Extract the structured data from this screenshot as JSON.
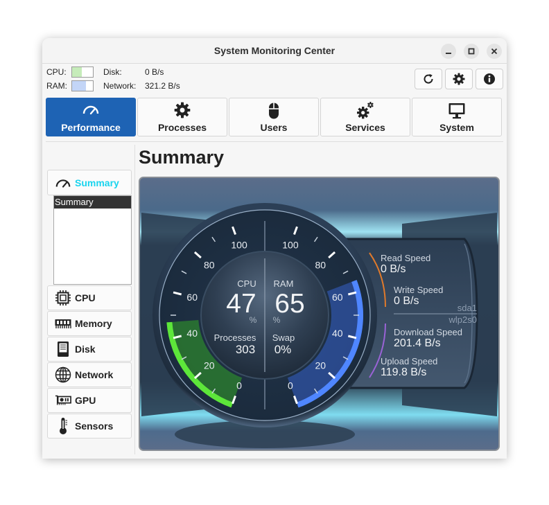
{
  "window": {
    "title": "System Monitoring Center"
  },
  "header": {
    "cpu_label": "CPU:",
    "ram_label": "RAM:",
    "cpu_usage": 0.47,
    "ram_usage": 0.65,
    "disk_label": "Disk:",
    "disk_value": "0 B/s",
    "network_label": "Network:",
    "network_value": "321.2 B/s"
  },
  "toolbar": {
    "refresh_icon": "refresh-icon",
    "settings_icon": "gear-icon",
    "about_icon": "info-icon"
  },
  "tabs": [
    {
      "label": "Performance",
      "icon": "speedometer-icon",
      "active": true
    },
    {
      "label": "Processes",
      "icon": "gear-icon"
    },
    {
      "label": "Users",
      "icon": "mouse-icon"
    },
    {
      "label": "Services",
      "icon": "gears-icon"
    },
    {
      "label": "System",
      "icon": "monitor-icon"
    }
  ],
  "sidebar": {
    "items": [
      {
        "label": "Summary",
        "icon": "speedometer-icon",
        "selected": true
      },
      {
        "label": "CPU",
        "icon": "cpu-icon"
      },
      {
        "label": "Memory",
        "icon": "memory-icon"
      },
      {
        "label": "Disk",
        "icon": "disk-icon"
      },
      {
        "label": "Network",
        "icon": "globe-icon"
      },
      {
        "label": "GPU",
        "icon": "gpu-icon"
      },
      {
        "label": "Sensors",
        "icon": "thermometer-icon"
      }
    ],
    "summary_list": [
      "Summary"
    ]
  },
  "main": {
    "title": "Summary",
    "gauge": {
      "cpu_label": "CPU",
      "cpu_value": "47",
      "cpu_unit": "%",
      "ram_label": "RAM",
      "ram_value": "65",
      "ram_unit": "%",
      "processes_label": "Processes",
      "processes_value": "303",
      "swap_label": "Swap",
      "swap_value": "0%",
      "cpu_scale": [
        "0",
        "20",
        "40",
        "60",
        "80",
        "100"
      ],
      "ram_scale": [
        "0",
        "20",
        "40",
        "60",
        "80",
        "100"
      ]
    },
    "io": {
      "read_label": "Read Speed",
      "read_value": "0 B/s",
      "write_label": "Write Speed",
      "write_value": "0 B/s",
      "disk_device": "sda1",
      "net_device": "wlp2s0",
      "download_label": "Download Speed",
      "download_value": "201.4 B/s",
      "upload_label": "Upload Speed",
      "upload_value": "119.8 B/s"
    },
    "colors": {
      "cpu": "#39c51e",
      "ram": "#3f6ff2",
      "disk": "#e07a2b",
      "network": "#9a63d6"
    }
  }
}
